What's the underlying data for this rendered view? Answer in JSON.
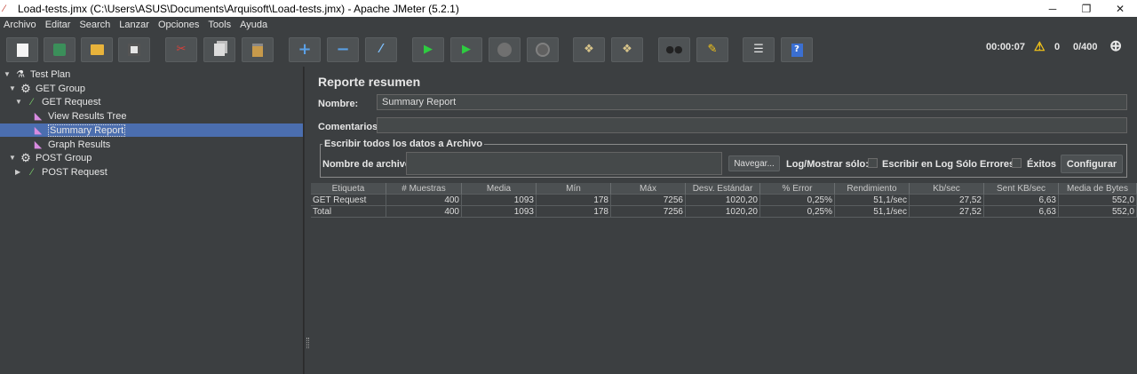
{
  "window": {
    "title": "Load-tests.jmx (C:\\Users\\ASUS\\Documents\\Arquisoft\\Load-tests.jmx) - Apache JMeter (5.2.1)",
    "minimize": "─",
    "maximize": "❐",
    "close": "✕"
  },
  "menu": [
    {
      "label": "Archivo"
    },
    {
      "label": "Editar"
    },
    {
      "label": "Search"
    },
    {
      "label": "Lanzar"
    },
    {
      "label": "Opciones"
    },
    {
      "label": "Tools"
    },
    {
      "label": "Ayuda"
    }
  ],
  "toolbar": {
    "elapsed": "00:00:07",
    "warnings": "0",
    "threads": "0/400"
  },
  "tree": [
    {
      "label": "Test Plan"
    },
    {
      "label": "GET Group"
    },
    {
      "label": "GET Request"
    },
    {
      "label": "View Results Tree"
    },
    {
      "label": "Summary Report"
    },
    {
      "label": "Graph Results"
    },
    {
      "label": "POST Group"
    },
    {
      "label": "POST Request"
    }
  ],
  "panel": {
    "title": "Reporte resumen",
    "name_label": "Nombre:",
    "name_value": "Summary Report",
    "comments_label": "Comentarios",
    "comments_value": "",
    "file_section": "Escribir todos los datos a Archivo",
    "filename_label": "Nombre de archivo",
    "filename_value": "",
    "browse_label": "Navegar...",
    "log_label": "Log/Mostrar sólo:",
    "errors_only_label": "Escribir en Log Sólo Errores",
    "success_label": "Éxitos",
    "configure_label": "Configurar"
  },
  "table": {
    "columns": [
      "Etiqueta",
      "# Muestras",
      "Media",
      "Mín",
      "Máx",
      "Desv. Estándar",
      "% Error",
      "Rendimiento",
      "Kb/sec",
      "Sent KB/sec",
      "Media de Bytes"
    ],
    "rows": [
      [
        "GET Request",
        "400",
        "1093",
        "178",
        "7256",
        "1020,20",
        "0,25%",
        "51,1/sec",
        "27,52",
        "6,63",
        "552,0"
      ],
      [
        "Total",
        "400",
        "1093",
        "178",
        "7256",
        "1020,20",
        "0,25%",
        "51,1/sec",
        "27,52",
        "6,63",
        "552,0"
      ]
    ]
  }
}
